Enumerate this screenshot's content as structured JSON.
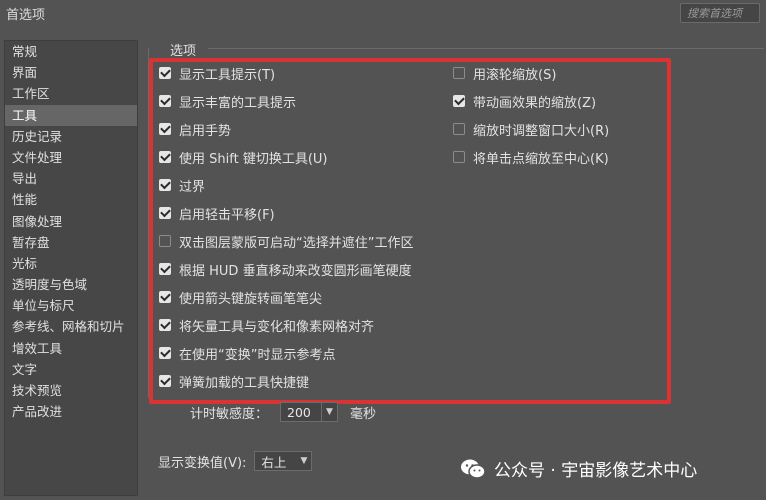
{
  "window": {
    "title": "首选项",
    "search_placeholder": "搜索首选项"
  },
  "sidebar": {
    "items": [
      {
        "label": "常规"
      },
      {
        "label": "界面"
      },
      {
        "label": "工作区"
      },
      {
        "label": "工具",
        "active": true
      },
      {
        "label": "历史记录"
      },
      {
        "label": "文件处理"
      },
      {
        "label": "导出"
      },
      {
        "label": "性能"
      },
      {
        "label": "图像处理"
      },
      {
        "label": "暂存盘"
      },
      {
        "label": "光标"
      },
      {
        "label": "透明度与色域"
      },
      {
        "label": "单位与标尺"
      },
      {
        "label": "参考线、网格和切片"
      },
      {
        "label": "增效工具"
      },
      {
        "label": "文字"
      },
      {
        "label": "技术预览"
      },
      {
        "label": "产品改进"
      }
    ]
  },
  "options": {
    "group_label": "选项",
    "left": [
      {
        "label": "显示工具提示(T)",
        "checked": true
      },
      {
        "label": "显示丰富的工具提示",
        "checked": true
      },
      {
        "label": "启用手势",
        "checked": true
      },
      {
        "label": "使用 Shift 键切换工具(U)",
        "checked": true
      },
      {
        "label": "过界",
        "checked": true
      },
      {
        "label": "启用轻击平移(F)",
        "checked": true
      },
      {
        "label": "双击图层蒙版可启动“选择并遮住”工作区",
        "checked": false
      },
      {
        "label": "根据 HUD 垂直移动来改变圆形画笔硬度",
        "checked": true
      },
      {
        "label": "使用箭头键旋转画笔笔尖",
        "checked": true
      },
      {
        "label": "将矢量工具与变化和像素网格对齐",
        "checked": true
      },
      {
        "label": "在使用“变换”时显示参考点",
        "checked": true
      },
      {
        "label": "弹簧加载的工具快捷键",
        "checked": true
      }
    ],
    "right": [
      {
        "label": "用滚轮缩放(S)",
        "checked": false
      },
      {
        "label": "带动画效果的缩放(Z)",
        "checked": true
      },
      {
        "label": "缩放时调整窗口大小(R)",
        "checked": false
      },
      {
        "label": "将单击点缩放至中心(K)",
        "checked": false
      }
    ]
  },
  "timing": {
    "label": "计时敏感度：",
    "value": "200",
    "unit": "毫秒"
  },
  "transform_values": {
    "label": "显示变换值(V):",
    "value": "右上"
  },
  "watermark": {
    "text": "公众号 · 宇宙影像艺术中心"
  },
  "colors": {
    "highlight_border": "#d93333",
    "background": "#535353"
  }
}
